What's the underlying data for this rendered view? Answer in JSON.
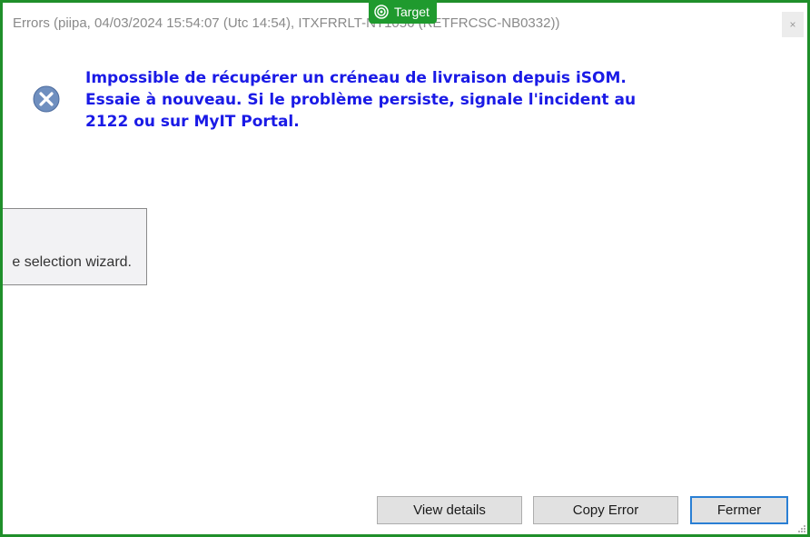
{
  "window": {
    "title": "Errors (piipa, 04/03/2024 15:54:07 (Utc 14:54), ITXFRRLT-NT1056 (RETFRCSC-NB0332))",
    "close_label": "×"
  },
  "badge": {
    "label": "Target",
    "icon": "target-icon",
    "color": "#1f9a2e"
  },
  "error": {
    "icon": "error-x-icon",
    "message_lines": [
      "Impossible de récupérer un créneau de livraison depuis iSOM.",
      "Essaie à nouveau. Si le problème persiste, signale l'incident au",
      "2122 ou sur MyIT Portal."
    ],
    "color": "#1a1ae6"
  },
  "background_panel": {
    "text": "e selection wizard."
  },
  "buttons": {
    "view_details": "View details",
    "copy_error": "Copy Error",
    "close": "Fermer"
  },
  "colors": {
    "frame_border": "#1f8f2a",
    "focus_border": "#2a7fd4"
  }
}
